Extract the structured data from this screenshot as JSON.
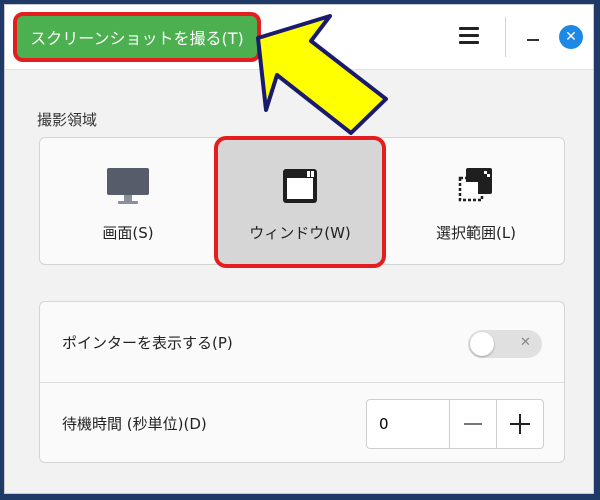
{
  "toolbar": {
    "capture_label": "スクリーンショットを撮る(T)"
  },
  "capture_area": {
    "title": "撮影領域",
    "options": [
      {
        "label": "画面(S)",
        "icon": "monitor-icon",
        "selected": false
      },
      {
        "label": "ウィンドウ(W)",
        "icon": "window-icon",
        "selected": true
      },
      {
        "label": "選択範囲(L)",
        "icon": "selection-icon",
        "selected": false
      }
    ]
  },
  "settings": {
    "show_pointer_label": "ポインターを表示する(P)",
    "show_pointer_on": false,
    "delay_label": "待機時間 (秒単位)(D)",
    "delay_value": "0"
  },
  "icons": {
    "menu": "hamburger-menu-icon",
    "minimize": "minimize-icon",
    "close": "close-icon",
    "pointer_toggle_off": "x-icon"
  },
  "colors": {
    "capture_button": "#4caf50",
    "highlight_outline": "#e41e1e",
    "close_button": "#1e88e5",
    "annotation_arrow": "#ffff00",
    "background": "#1f3a66"
  }
}
